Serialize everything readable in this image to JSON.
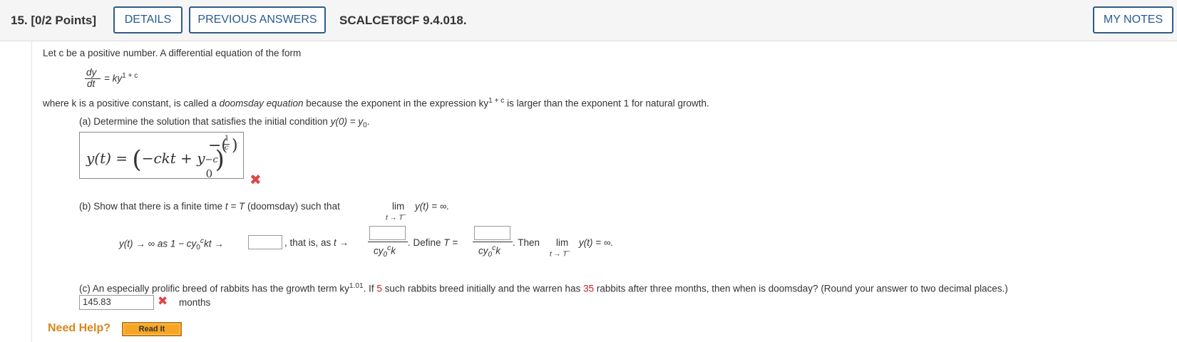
{
  "header": {
    "question_number": "15.",
    "points": "[0/2 Points]",
    "details_label": "DETAILS",
    "previous_answers_label": "PREVIOUS ANSWERS",
    "question_code": "SCALCET8CF 9.4.018.",
    "my_notes_label": "MY NOTES"
  },
  "intro": {
    "text": "Let c be a positive number. A differential equation of the form",
    "eq_num": "dy",
    "eq_den": "dt",
    "eq_rhs": "= ky",
    "eq_exp": "1 + c",
    "where_pre": "where k is a positive constant, is called a",
    "doomsday": "doomsday equation",
    "where_mid": "because the exponent in the expression ky",
    "where_exp": "1 + c",
    "where_post": "is larger than the exponent 1 for natural growth."
  },
  "part_a": {
    "prompt": "(a) Determine the solution that satisfies the initial condition",
    "condition": "y(0) = y",
    "condition_sub": "0",
    "answer_lhs": "y(t) = ",
    "answer_inner": "−ckt + y",
    "answer_inner_exp": "−c",
    "answer_inner_sub": "0",
    "answer_outer_exp_num": "1",
    "answer_outer_exp_den": "c",
    "status": "incorrect"
  },
  "part_b": {
    "prompt": "(b) Show that there is a finite time",
    "t_eq": "t = T",
    "doomsday_word": "(doomsday) such that",
    "lim": "lim",
    "lim_sub": "t → T",
    "lim_sup": "−",
    "lim_expr": "y(t) = ∞.",
    "line2_a": "y(t) → ∞ as 1 − cy",
    "line2_sub": "0",
    "line2_sup": "c",
    "line2_b": "kt →",
    "that_is": ", that is, as",
    "t_arrow": "t →",
    "frac_den": "cy",
    "frac_den_sub": "0",
    "frac_den_sup": "c",
    "frac_den_k": "k",
    "define": ". Define",
    "define_T": "T =",
    "then": ". Then",
    "then_lim": "lim",
    "then_lim_sub": "t → T",
    "then_lim_sup": "−",
    "then_expr": "y(t) = ∞."
  },
  "part_c": {
    "prompt_a": "(c) An especially prolific breed of rabbits has the growth term ky",
    "prompt_exp": "1.01",
    "prompt_b": ". If",
    "num1": "5",
    "prompt_c": "such rabbits breed initially and the warren has",
    "num2": "35",
    "prompt_d": "rabbits after three months, then when is doomsday? (Round your answer to two decimal places.)",
    "answer_value": "145.83",
    "units": "months",
    "status": "incorrect"
  },
  "help": {
    "need_help": "Need Help?",
    "read_it": "Read It"
  },
  "colors": {
    "accent": "#2a5a8c",
    "error": "#e04545",
    "highlight_number": "#cc2222",
    "help": "#d9861b",
    "read_it_bg": "#f6a623"
  }
}
